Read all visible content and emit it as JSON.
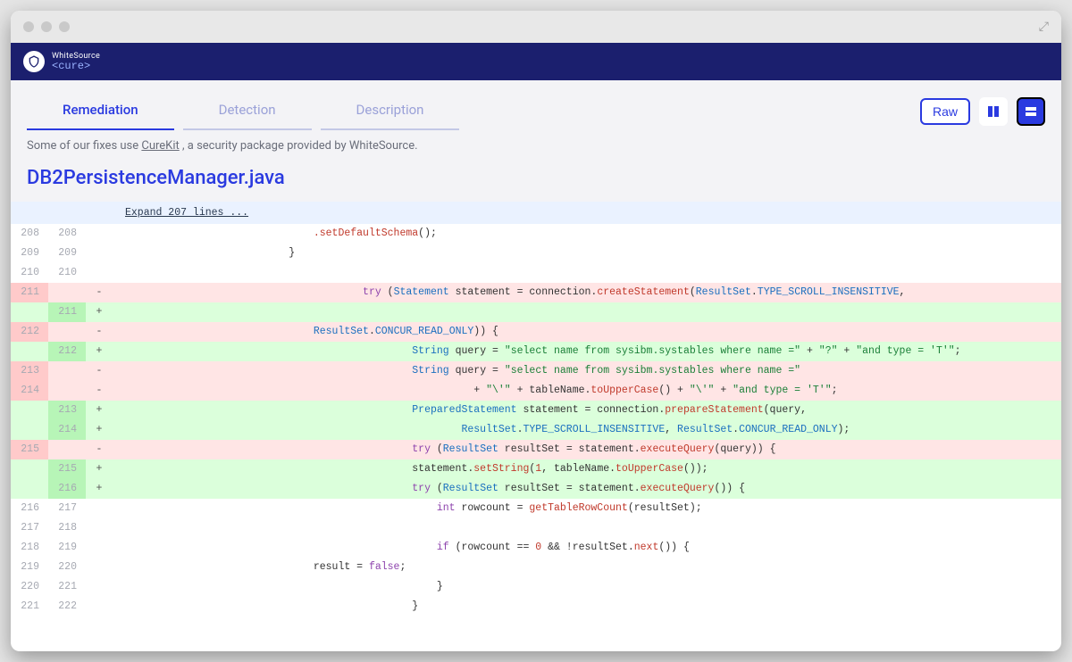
{
  "brand": {
    "top": "WhiteSource",
    "bottom": "<cure>"
  },
  "tabs": {
    "remediation": "Remediation",
    "detection": "Detection",
    "description": "Description"
  },
  "buttons": {
    "raw": "Raw"
  },
  "note": {
    "prefix": "Some of our fixes use ",
    "link": "CureKit",
    "suffix": " , a security package provided by WhiteSource."
  },
  "filename": "DB2PersistenceManager.java",
  "expand": "Expand 207 lines ...",
  "lines": [
    {
      "old": "208",
      "new": "208",
      "type": "ctx",
      "indent": 32,
      "tokens": [
        {
          "t": ".setDefaultSchema",
          "c": "method"
        },
        {
          "t": "();"
        }
      ]
    },
    {
      "old": "209",
      "new": "209",
      "type": "ctx",
      "indent": 28,
      "tokens": [
        {
          "t": "}"
        }
      ]
    },
    {
      "old": "210",
      "new": "210",
      "type": "ctx",
      "indent": 0,
      "tokens": [
        {
          "t": ""
        }
      ]
    },
    {
      "old": "211",
      "new": "",
      "type": "del",
      "indent": 40,
      "tokens": [
        {
          "t": "try ",
          "c": "kw"
        },
        {
          "t": "("
        },
        {
          "t": "Statement",
          "c": "type"
        },
        {
          "t": " statement = connection."
        },
        {
          "t": "createStatement",
          "c": "method"
        },
        {
          "t": "("
        },
        {
          "t": "ResultSet",
          "c": "type"
        },
        {
          "t": "."
        },
        {
          "t": "TYPE_SCROLL_INSENSITIVE",
          "c": "type"
        },
        {
          "t": ","
        }
      ]
    },
    {
      "old": "",
      "new": "211",
      "type": "add",
      "indent": 0,
      "tokens": [
        {
          "t": ""
        }
      ]
    },
    {
      "old": "212",
      "new": "",
      "type": "del",
      "indent": 32,
      "tokens": [
        {
          "t": "ResultSet",
          "c": "type"
        },
        {
          "t": "."
        },
        {
          "t": "CONCUR_READ_ONLY",
          "c": "type"
        },
        {
          "t": ")) {"
        }
      ]
    },
    {
      "old": "",
      "new": "212",
      "type": "add",
      "indent": 48,
      "tokens": [
        {
          "t": "String",
          "c": "type"
        },
        {
          "t": " query = "
        },
        {
          "t": "\"select name from sysibm.systables where name =\"",
          "c": "str"
        },
        {
          "t": " + "
        },
        {
          "t": "\"?\"",
          "c": "str"
        },
        {
          "t": " + "
        },
        {
          "t": "\"and type = 'T'\"",
          "c": "str"
        },
        {
          "t": ";"
        }
      ]
    },
    {
      "old": "213",
      "new": "",
      "type": "del",
      "indent": 48,
      "tokens": [
        {
          "t": "String",
          "c": "type"
        },
        {
          "t": " query = "
        },
        {
          "t": "\"select name from sysibm.systables where name =\"",
          "c": "str"
        }
      ]
    },
    {
      "old": "214",
      "new": "",
      "type": "del",
      "indent": 58,
      "tokens": [
        {
          "t": "+ "
        },
        {
          "t": "\"\\'\"",
          "c": "str"
        },
        {
          "t": " + tableName."
        },
        {
          "t": "toUpperCase",
          "c": "method"
        },
        {
          "t": "() + "
        },
        {
          "t": "\"\\'\"",
          "c": "str"
        },
        {
          "t": " + "
        },
        {
          "t": "\"and type = 'T'\"",
          "c": "str"
        },
        {
          "t": ";"
        }
      ]
    },
    {
      "old": "",
      "new": "213",
      "type": "add",
      "indent": 48,
      "tokens": [
        {
          "t": "PreparedStatement",
          "c": "type"
        },
        {
          "t": " statement = connection."
        },
        {
          "t": "prepareStatement",
          "c": "method"
        },
        {
          "t": "(query,"
        }
      ]
    },
    {
      "old": "",
      "new": "214",
      "type": "add",
      "indent": 56,
      "tokens": [
        {
          "t": "ResultSet",
          "c": "type"
        },
        {
          "t": "."
        },
        {
          "t": "TYPE_SCROLL_INSENSITIVE",
          "c": "type"
        },
        {
          "t": ", "
        },
        {
          "t": "ResultSet",
          "c": "type"
        },
        {
          "t": "."
        },
        {
          "t": "CONCUR_READ_ONLY",
          "c": "type"
        },
        {
          "t": ");"
        }
      ]
    },
    {
      "old": "215",
      "new": "",
      "type": "del",
      "indent": 48,
      "tokens": [
        {
          "t": "try ",
          "c": "kw"
        },
        {
          "t": "("
        },
        {
          "t": "ResultSet",
          "c": "type"
        },
        {
          "t": " resultSet = statement."
        },
        {
          "t": "executeQuery",
          "c": "method"
        },
        {
          "t": "(query)) {"
        }
      ]
    },
    {
      "old": "",
      "new": "215",
      "type": "add",
      "indent": 48,
      "tokens": [
        {
          "t": "statement."
        },
        {
          "t": "setString",
          "c": "method"
        },
        {
          "t": "("
        },
        {
          "t": "1",
          "c": "num"
        },
        {
          "t": ", tableName."
        },
        {
          "t": "toUpperCase",
          "c": "method"
        },
        {
          "t": "());"
        }
      ]
    },
    {
      "old": "",
      "new": "216",
      "type": "add",
      "indent": 48,
      "tokens": [
        {
          "t": "try ",
          "c": "kw"
        },
        {
          "t": "("
        },
        {
          "t": "ResultSet",
          "c": "type"
        },
        {
          "t": " resultSet = statement."
        },
        {
          "t": "executeQuery",
          "c": "method"
        },
        {
          "t": "()) {"
        }
      ]
    },
    {
      "old": "216",
      "new": "217",
      "type": "ctx",
      "indent": 52,
      "tokens": [
        {
          "t": "int ",
          "c": "kw"
        },
        {
          "t": "rowcount = "
        },
        {
          "t": "getTableRowCount",
          "c": "method"
        },
        {
          "t": "(resultSet);"
        }
      ]
    },
    {
      "old": "217",
      "new": "218",
      "type": "ctx",
      "indent": 0,
      "tokens": [
        {
          "t": ""
        }
      ]
    },
    {
      "old": "218",
      "new": "219",
      "type": "ctx",
      "indent": 52,
      "tokens": [
        {
          "t": "if ",
          "c": "kw"
        },
        {
          "t": "(rowcount == "
        },
        {
          "t": "0",
          "c": "num"
        },
        {
          "t": " && !resultSet."
        },
        {
          "t": "next",
          "c": "method"
        },
        {
          "t": "()) {"
        }
      ]
    },
    {
      "old": "219",
      "new": "220",
      "type": "ctx",
      "indent": 32,
      "tokens": [
        {
          "t": "result = "
        },
        {
          "t": "false",
          "c": "kw"
        },
        {
          "t": ";"
        }
      ]
    },
    {
      "old": "220",
      "new": "221",
      "type": "ctx",
      "indent": 52,
      "tokens": [
        {
          "t": "}"
        }
      ]
    },
    {
      "old": "221",
      "new": "222",
      "type": "ctx",
      "indent": 48,
      "tokens": [
        {
          "t": "}"
        }
      ]
    }
  ]
}
